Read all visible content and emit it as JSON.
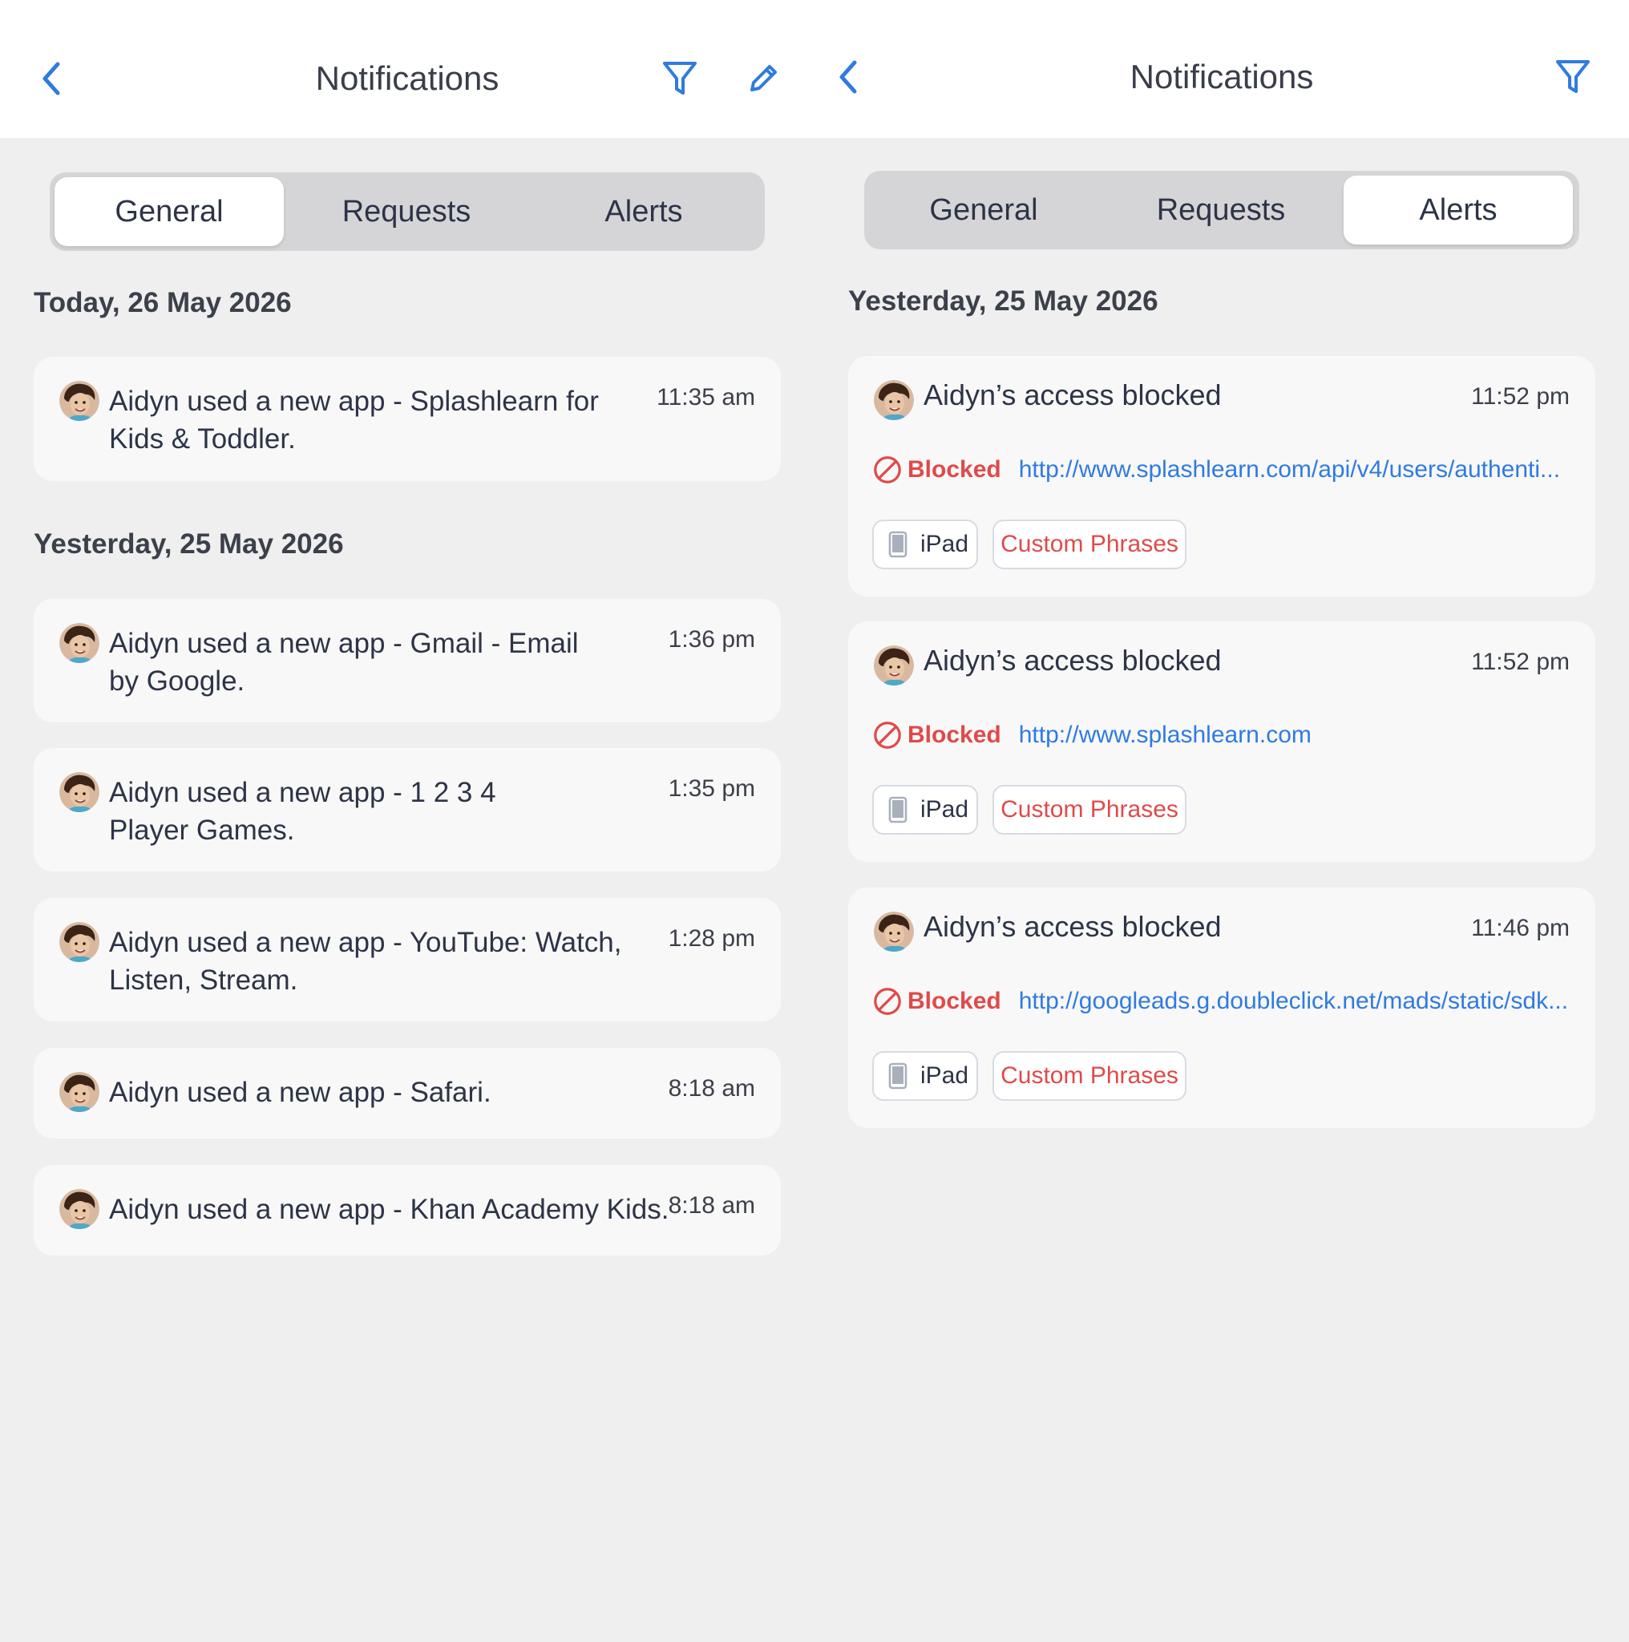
{
  "left": {
    "header": {
      "title": "Notifications",
      "back_icon": "chevron-left-icon",
      "filter_icon": "filter-icon",
      "edit_icon": "pencil-icon"
    },
    "tabs": [
      {
        "label": "General",
        "active": true
      },
      {
        "label": "Requests",
        "active": false
      },
      {
        "label": "Alerts",
        "active": false
      }
    ],
    "sections": [
      {
        "heading": "Today, 26 May 2026",
        "items": [
          {
            "line1": "Aidyn used a new app - Splashlearn for",
            "line2": "Kids & Toddler.",
            "time": "11:35 am"
          }
        ]
      },
      {
        "heading": "Yesterday, 25 May 2026",
        "items": [
          {
            "line1": "Aidyn used a new app - Gmail - Email",
            "line2": "by Google.",
            "time": "1:36 pm"
          },
          {
            "line1": "Aidyn used a new app - 1 2 3 4",
            "line2": "Player Games.",
            "time": "1:35 pm"
          },
          {
            "line1": "Aidyn used a new app - YouTube: Watch,",
            "line2": "Listen, Stream.",
            "time": "1:28 pm"
          },
          {
            "line1": "Aidyn used a new app - Safari.",
            "time": "8:18 am"
          },
          {
            "line1": "Aidyn used a new app - Khan Academy Kids.",
            "time": "8:18 am"
          }
        ]
      }
    ]
  },
  "right": {
    "header": {
      "title": "Notifications",
      "back_icon": "chevron-left-icon",
      "filter_icon": "filter-icon"
    },
    "tabs": [
      {
        "label": "General",
        "active": false
      },
      {
        "label": "Requests",
        "active": false
      },
      {
        "label": "Alerts",
        "active": true
      }
    ],
    "section_heading": "Yesterday, 25 May 2026",
    "alerts": [
      {
        "title": "Aidyn’s access blocked",
        "time": "11:52 pm",
        "status": "Blocked",
        "url": "http://www.splashlearn.com/api/v4/users/authenti...",
        "device": "iPad",
        "category": "Custom Phrases"
      },
      {
        "title": "Aidyn’s access blocked",
        "time": "11:52 pm",
        "status": "Blocked",
        "url": "http://www.splashlearn.com",
        "device": "iPad",
        "category": "Custom Phrases"
      },
      {
        "title": "Aidyn’s access blocked",
        "time": "11:46 pm",
        "status": "Blocked",
        "url": "http://googleads.g.doubleclick.net/mads/static/sdk...",
        "device": "iPad",
        "category": "Custom Phrases"
      }
    ]
  },
  "colors": {
    "accent": "#2f7be0",
    "blocked": "#e04a4a",
    "background": "#efefef",
    "card": "#f8f8f8"
  }
}
